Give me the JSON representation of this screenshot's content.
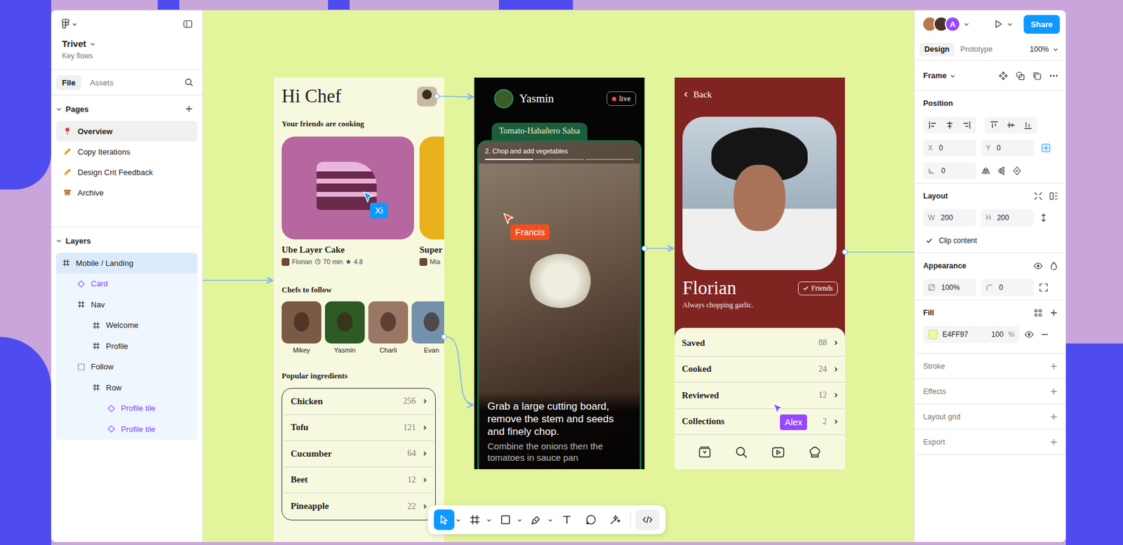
{
  "app": {
    "file_name": "Trivet",
    "file_subtitle": "Key flows"
  },
  "sidebar_tabs": [
    {
      "label": "File",
      "selected": true
    },
    {
      "label": "Assets",
      "selected": false
    }
  ],
  "pages": {
    "title": "Pages",
    "items": [
      {
        "label": "Overview",
        "kind": "pin",
        "selected": true
      },
      {
        "label": "Copy Iterations",
        "kind": "pencil",
        "selected": false
      },
      {
        "label": "Design Crit Feedback",
        "kind": "pencil",
        "selected": false
      },
      {
        "label": "Archive",
        "kind": "archive",
        "selected": false
      }
    ]
  },
  "layers": {
    "title": "Layers",
    "items": [
      {
        "name": "Mobile / Landing",
        "depth": 0,
        "kind": "frame",
        "selected": true,
        "highlighted": true
      },
      {
        "name": "Card",
        "depth": 1,
        "kind": "instance",
        "selected": false,
        "highlighted": true
      },
      {
        "name": "Nav",
        "depth": 1,
        "kind": "frame",
        "selected": false,
        "highlighted": true
      },
      {
        "name": "Welcome",
        "depth": 2,
        "kind": "frame",
        "selected": false,
        "highlighted": true
      },
      {
        "name": "Profile",
        "depth": 2,
        "kind": "frame",
        "selected": false,
        "highlighted": true
      },
      {
        "name": "Follow",
        "depth": 1,
        "kind": "layout",
        "selected": false,
        "highlighted": true
      },
      {
        "name": "Row",
        "depth": 2,
        "kind": "frame",
        "selected": false,
        "highlighted": true
      },
      {
        "name": "Profile tile",
        "depth": 3,
        "kind": "instance",
        "selected": false,
        "highlighted": true
      },
      {
        "name": "Profile tile",
        "depth": 3,
        "kind": "instance",
        "selected": false,
        "highlighted": true
      }
    ]
  },
  "collaborators": [
    {
      "kind": "photo",
      "color": "#b9774f"
    },
    {
      "kind": "photo",
      "color": "#4a3328"
    },
    {
      "kind": "initial",
      "label": "A",
      "color": "#9747ff"
    }
  ],
  "share": "Share",
  "panel_tabs": [
    {
      "label": "Design",
      "selected": true
    },
    {
      "label": "Prototype",
      "selected": false
    }
  ],
  "zoom": "100%",
  "selection_type": "Frame",
  "position": {
    "title": "Position",
    "fields": [
      {
        "label": "X",
        "value": "0"
      },
      {
        "label": "Y",
        "value": "0"
      }
    ],
    "rotation": "0"
  },
  "layout": {
    "title": "Layout",
    "fields": [
      {
        "label": "W",
        "value": "200"
      },
      {
        "label": "H",
        "value": "200"
      }
    ],
    "clip": {
      "label": "Clip content",
      "checked": true
    }
  },
  "appearance": {
    "title": "Appearance",
    "opacity": "100%",
    "radius": "0"
  },
  "fill": {
    "title": "Fill",
    "hex": "E4FF97",
    "color": "#E4FF97",
    "opacity": "100",
    "unit": "%"
  },
  "sections": [
    "Stroke",
    "Effects",
    "Layout grid",
    "Export"
  ],
  "toolbar": [
    {
      "kind": "move",
      "selected": true,
      "menu": true
    },
    {
      "kind": "frame",
      "selected": false,
      "menu": true
    },
    {
      "kind": "shape",
      "selected": false,
      "menu": true
    },
    {
      "kind": "pen",
      "selected": false,
      "menu": true
    },
    {
      "kind": "text",
      "selected": false,
      "menu": false
    },
    {
      "kind": "comment",
      "selected": false,
      "menu": false
    },
    {
      "kind": "ai",
      "selected": false,
      "menu": false
    },
    {
      "kind": "code",
      "selected": false,
      "menu": false
    }
  ],
  "cursors": [
    {
      "name": "Xi",
      "color": "#0d99ff"
    },
    {
      "name": "Francis",
      "color": "#f24e1e"
    },
    {
      "name": "Alex",
      "color": "#9747ff"
    }
  ],
  "home": {
    "greeting": "Hi Chef",
    "friends_title": "Your friends are cooking",
    "recipes": [
      {
        "title": "Ube Layer Cake",
        "author": "Florian",
        "time": "70 min",
        "rating": "4.8",
        "color": "#b7679f"
      },
      {
        "title": "Super",
        "author": "Mia",
        "color": "#e9b21c"
      }
    ],
    "chefs_title": "Chefs to follow",
    "chefs": [
      {
        "name": "Mikey",
        "color": "#7a5a45"
      },
      {
        "name": "Yasmin",
        "color": "#2d5a25"
      },
      {
        "name": "Charli",
        "color": "#9a7664"
      },
      {
        "name": "Evan",
        "color": "#7391ad"
      }
    ],
    "ingredients_title": "Popular ingredients",
    "ingredients": [
      {
        "name": "Chicken",
        "count": "256"
      },
      {
        "name": "Tofu",
        "count": "121"
      },
      {
        "name": "Cucumber",
        "count": "64"
      },
      {
        "name": "Beet",
        "count": "12"
      },
      {
        "name": "Pineapple",
        "count": "22"
      }
    ]
  },
  "live": {
    "chef": "Yasmin",
    "badge": "live",
    "recipe": "Tomato-Habañero Salsa",
    "step": "2. Chop and add vegetables",
    "progress": [
      1,
      0,
      0
    ],
    "instruction": "Grab a large cutting board, remove the stem and seeds and finely chop.",
    "next": "Combine the onions then the tomatoes in sauce pan"
  },
  "profile": {
    "back": "Back",
    "name": "Florian",
    "badge": "Friends",
    "bio": "Always chopping garlic.",
    "stats": [
      {
        "label": "Saved",
        "count": "88"
      },
      {
        "label": "Cooked",
        "count": "24"
      },
      {
        "label": "Reviewed",
        "count": "12"
      },
      {
        "label": "Collections",
        "count": "2"
      }
    ],
    "nav": [
      {
        "kind": "saved"
      },
      {
        "kind": "search"
      },
      {
        "kind": "play"
      },
      {
        "kind": "chef"
      }
    ]
  }
}
